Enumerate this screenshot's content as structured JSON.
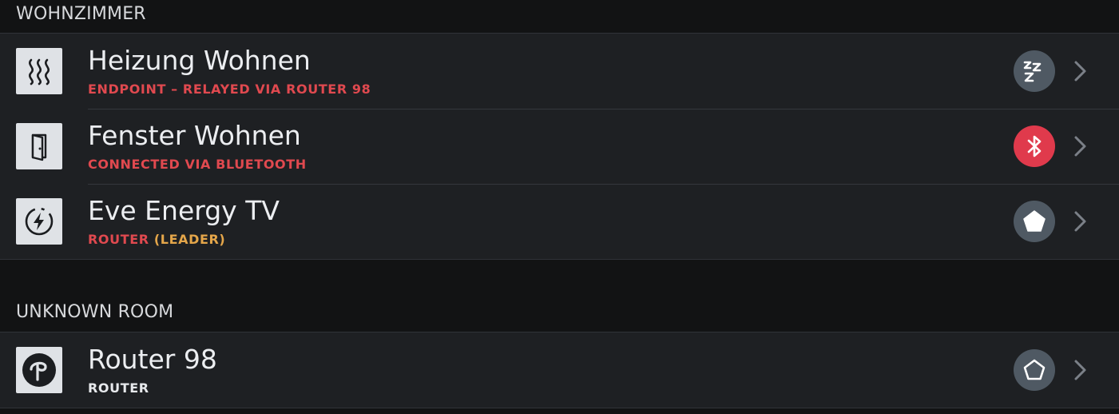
{
  "sections": [
    {
      "title": "WOHNZIMMER",
      "devices": [
        {
          "name": "Heizung Wohnen",
          "subtitle": "ENDPOINT – RELAYED VIA ROUTER 98",
          "icon": "heating-icon",
          "status_icon": "sleep-icon"
        },
        {
          "name": "Fenster Wohnen",
          "subtitle": "CONNECTED VIA BLUETOOTH",
          "icon": "door-icon",
          "status_icon": "bluetooth-icon"
        },
        {
          "name": "Eve Energy TV",
          "subtitle": "ROUTER",
          "subtitle_extra": "(LEADER)",
          "icon": "energy-icon",
          "status_icon": "pentagon-filled-icon"
        }
      ]
    },
    {
      "title": "UNKNOWN ROOM",
      "devices": [
        {
          "name": "Router 98",
          "subtitle": "ROUTER",
          "icon": "router-icon",
          "status_icon": "pentagon-outline-icon"
        }
      ]
    }
  ],
  "colors": {
    "background": "#121314",
    "row_background": "#1e2023",
    "status_red": "#e0494f",
    "status_orange": "#e4a64a",
    "bluetooth_badge": "#e03a4c",
    "badge_gray": "#4f5963"
  }
}
